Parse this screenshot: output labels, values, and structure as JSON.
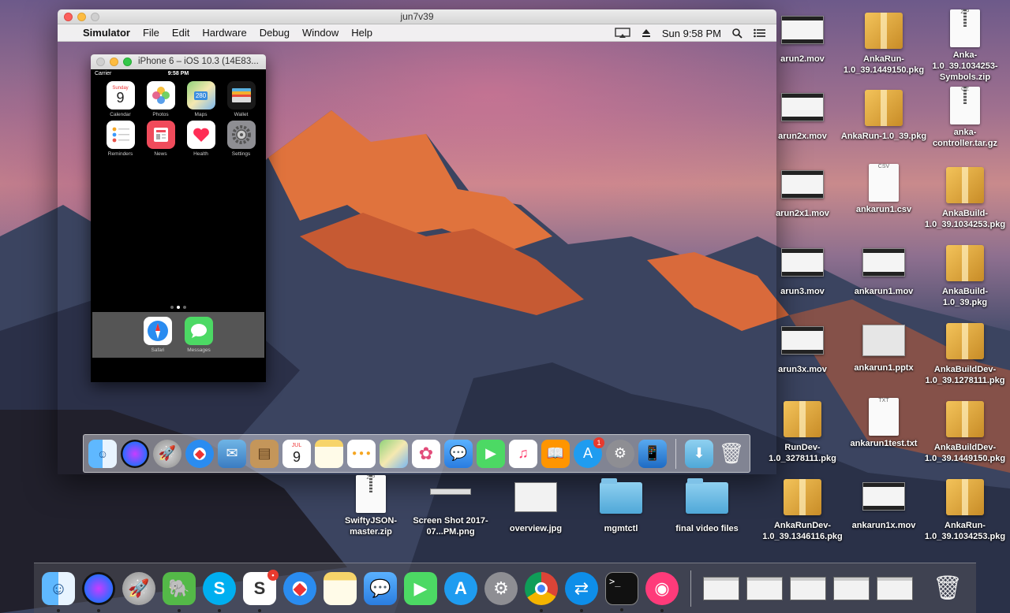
{
  "vm_window": {
    "title": "jun7v39",
    "menubar": {
      "app_name": "Simulator",
      "items": [
        "File",
        "Edit",
        "Hardware",
        "Debug",
        "Window",
        "Help"
      ],
      "clock": "Sun 9:58 PM"
    }
  },
  "simulator": {
    "title": "iPhone 6 – iOS 10.3 (14E83...",
    "status": {
      "carrier": "Carrier",
      "time": "9:58 PM"
    },
    "calendar": {
      "weekday": "Sunday",
      "day": "9"
    },
    "apps": [
      "Calendar",
      "Photos",
      "Maps",
      "Wallet",
      "Reminders",
      "News",
      "Health",
      "Settings"
    ],
    "dock_apps": [
      "Safari",
      "Messages"
    ]
  },
  "inner_dock": {
    "calendar": {
      "month": "JUL",
      "day": "9"
    },
    "app_store_badge": "1"
  },
  "desktop_inner": [
    {
      "name": "SwiftyJSON-master.zip",
      "kind": "zip",
      "tag": "ZIP"
    },
    {
      "name": "Screen Shot 2017-07...PM.png",
      "kind": "shot"
    },
    {
      "name": "overview.jpg",
      "kind": "shot"
    },
    {
      "name": "mgmtctl",
      "kind": "folder"
    },
    {
      "name": "final video files",
      "kind": "folder"
    }
  ],
  "desktop_right": [
    {
      "name": "arun2.mov",
      "kind": "vid"
    },
    {
      "name": "AnkaRun-1.0_39.1449150.pkg",
      "kind": "pkg"
    },
    {
      "name": "Anka-1.0_39.1034253-Symbols.zip",
      "kind": "zip",
      "tag": "ZIP"
    },
    {
      "name": "arun2x.mov",
      "kind": "vid"
    },
    {
      "name": "AnkaRun-1.0_39.pkg",
      "kind": "pkg"
    },
    {
      "name": "anka-controller.tar.gz",
      "kind": "zip",
      "tag": "GZ"
    },
    {
      "name": "arun2x1.mov",
      "kind": "vid"
    },
    {
      "name": "ankarun1.csv",
      "kind": "doc",
      "tag": "CSV"
    },
    {
      "name": "AnkaBuild-1.0_39.1034253.pkg",
      "kind": "pkg"
    },
    {
      "name": "arun3.mov",
      "kind": "vid"
    },
    {
      "name": "ankarun1.mov",
      "kind": "vid"
    },
    {
      "name": "AnkaBuild-1.0_39.pkg",
      "kind": "pkg"
    },
    {
      "name": "arun3x.mov",
      "kind": "vid"
    },
    {
      "name": "ankarun1.pptx",
      "kind": "slide"
    },
    {
      "name": "AnkaBuildDev-1.0_39.1278111.pkg",
      "kind": "pkg"
    },
    {
      "name": "RunDev-1.0_3278111.pkg",
      "kind": "pkg"
    },
    {
      "name": "ankarun1test.txt",
      "kind": "doc",
      "tag": "TXT"
    },
    {
      "name": "AnkaBuildDev-1.0_39.1449150.pkg",
      "kind": "pkg"
    },
    {
      "name": "AnkaRunDev-1.0_39.1346116.pkg",
      "kind": "pkg"
    },
    {
      "name": "ankarun1x.mov",
      "kind": "vid"
    },
    {
      "name": "AnkaRun-1.0_39.1034253.pkg",
      "kind": "pkg"
    }
  ],
  "colors": {
    "accent_blue": "#1f7ff0",
    "badge_red": "#e83a2e"
  }
}
